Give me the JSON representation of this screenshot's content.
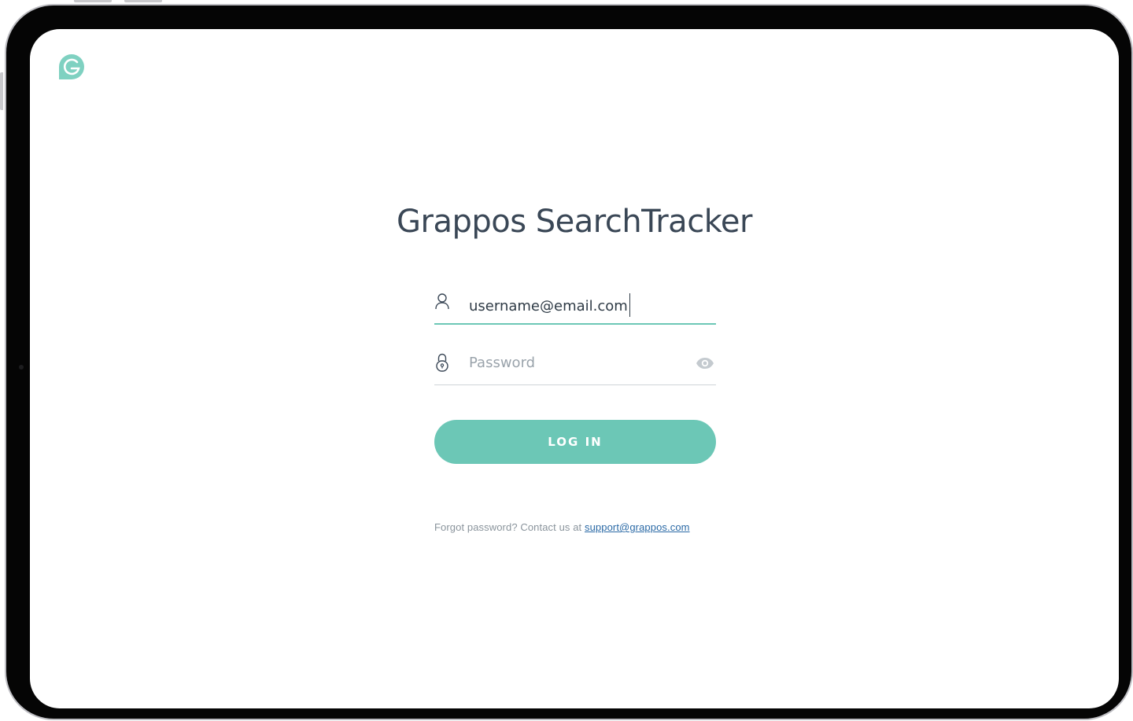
{
  "app": {
    "title": "Grappos SearchTracker",
    "logo_icon": "grappos-logo-icon",
    "brand_color": "#6cc7b6"
  },
  "login_form": {
    "email": {
      "icon": "user-icon",
      "value": "username@email.com"
    },
    "password": {
      "icon": "lock-icon",
      "placeholder": "Password",
      "toggle_icon": "eye-icon"
    },
    "submit_label": "LOG IN"
  },
  "footer": {
    "forgot_text": "Forgot password? Contact us at",
    "support_email": "support@grappos.com"
  }
}
